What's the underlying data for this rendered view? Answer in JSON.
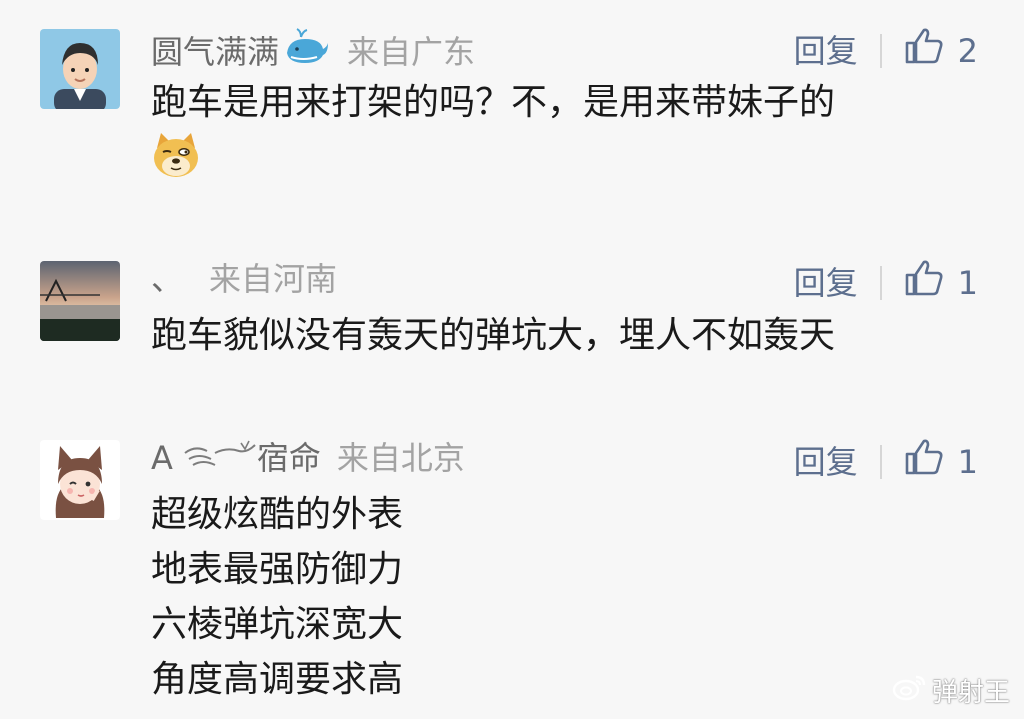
{
  "comments": [
    {
      "user": "圆气满满",
      "badge_icon": "whale-icon",
      "location": "来自广东",
      "reply_label": "回复",
      "likes": "2",
      "text_lines": [
        "跑车是用来打架的吗？不，是用来带妹子的"
      ],
      "emoji_icon": "doge-emoji-icon"
    },
    {
      "user": "、",
      "location": "来自河南",
      "reply_label": "回复",
      "likes": "1",
      "text_lines": [
        "跑车貌似没有轰天的弹坑大，埋人不如轰天"
      ]
    },
    {
      "user": "A",
      "user_suffix": "宿命",
      "location": "来自北京",
      "reply_label": "回复",
      "likes": "1",
      "text_lines": [
        "超级炫酷的外表",
        "地表最强防御力",
        "六棱弹坑深宽大",
        "角度高调要求高"
      ]
    }
  ],
  "watermark": {
    "text": "弹射王",
    "icon": "weibo-logo-icon"
  }
}
